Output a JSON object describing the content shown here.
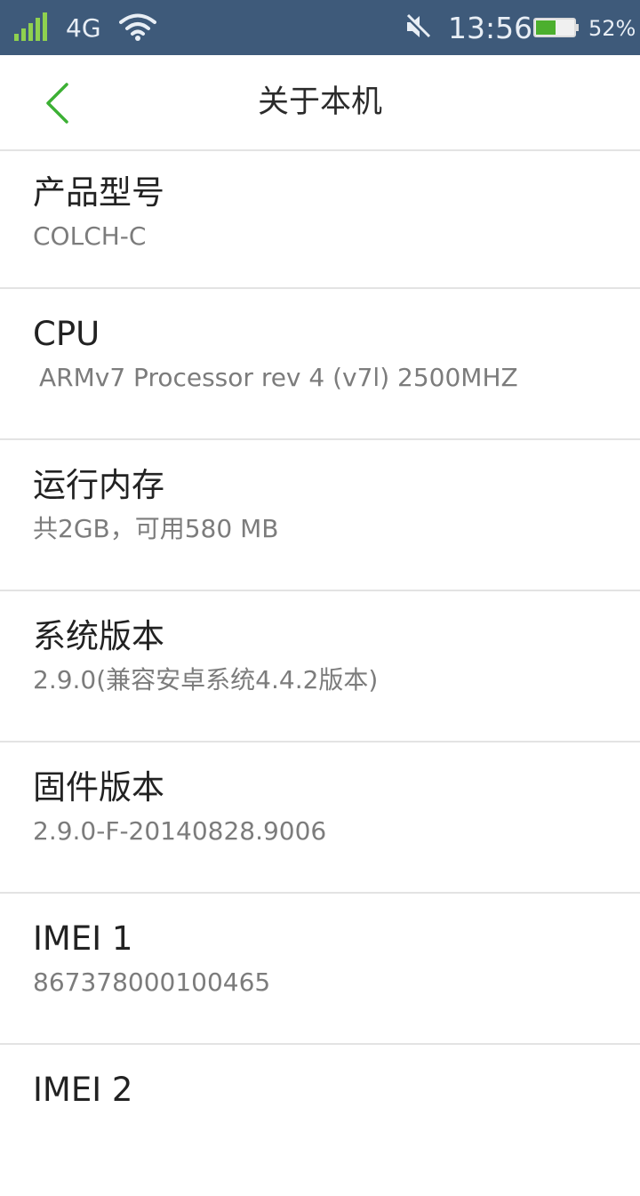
{
  "status_bar": {
    "network_type": "4G",
    "time": "13:56",
    "battery_percent": "52%",
    "battery_level": 0.52,
    "icons": [
      "signal-icon",
      "wifi-icon",
      "mute-icon",
      "battery-icon"
    ]
  },
  "header": {
    "title": "关于本机",
    "back_icon": "chevron-left-icon",
    "accent_color": "#3cb034"
  },
  "items": [
    {
      "label": "产品型号",
      "value": "COLCH-C"
    },
    {
      "label": "CPU",
      "value": "ARMv7 Processor rev 4 (v7l) 2500MHZ"
    },
    {
      "label": "运行内存",
      "value": "共2GB，可用580 MB"
    },
    {
      "label": "系统版本",
      "value": "2.9.0(兼容安卓系统4.4.2版本)"
    },
    {
      "label": "固件版本",
      "value": "2.9.0-F-20140828.9006"
    },
    {
      "label": "IMEI 1",
      "value": "867378000100465"
    },
    {
      "label": "IMEI 2",
      "value": ""
    }
  ]
}
